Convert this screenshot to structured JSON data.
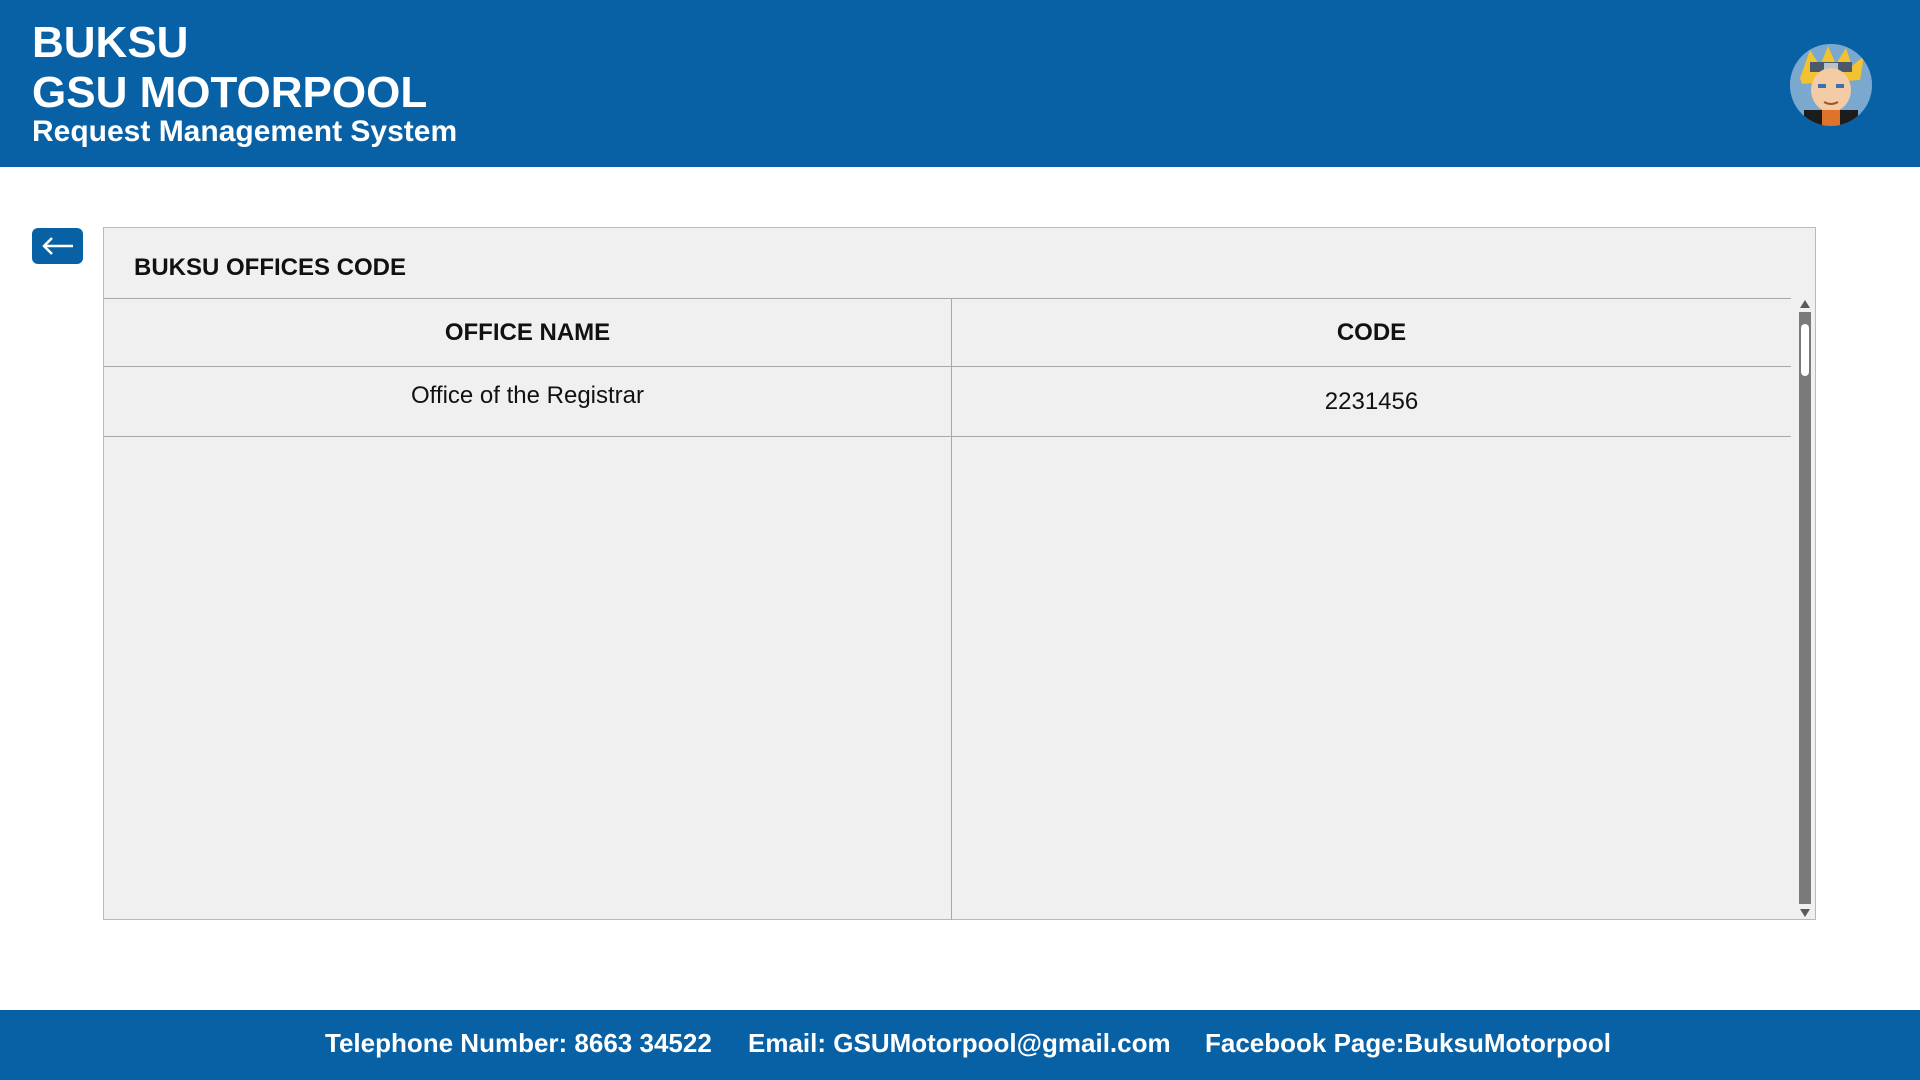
{
  "header": {
    "brand_line1": "BUKSU",
    "brand_line2": "GSU MOTORPOOL",
    "brand_line3": "Request Management System"
  },
  "back_button": {
    "icon": "arrow-left-icon"
  },
  "panel": {
    "title": "BUKSU OFFICES CODE",
    "columns": [
      "OFFICE NAME",
      "CODE"
    ],
    "rows": [
      {
        "office_name": "Office of the Registrar",
        "code": "2231456"
      }
    ]
  },
  "footer": {
    "telephone": "Telephone Number: 8663 34522",
    "email": "Email: GSUMotorpool@gmail.com",
    "facebook": "Facebook Page:BuksuMotorpool"
  },
  "colors": {
    "brand_blue": "#0961a5",
    "panel_bg": "#f0f0f0",
    "border": "#a8a8a8"
  }
}
